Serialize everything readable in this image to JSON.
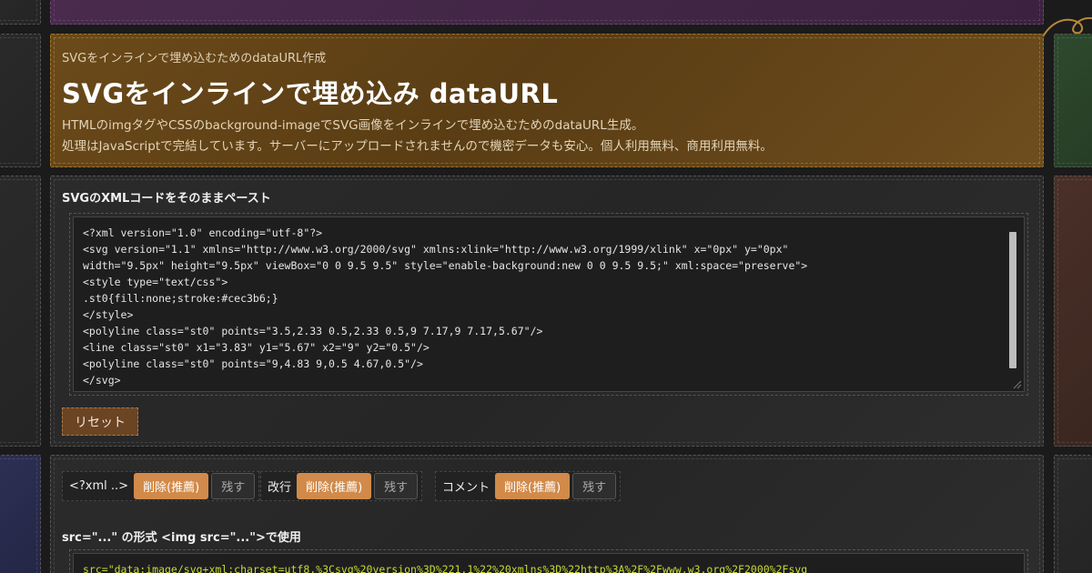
{
  "header": {
    "subtitle": "SVGをインラインで埋め込むためのdataURL作成",
    "title": "SVGをインラインで埋め込み dataURL",
    "description_line1": "HTMLのimgタグやCSSのbackground-imageでSVG画像をインラインで埋め込むためのdataURL生成。",
    "description_line2": "処理はJavaScriptで完結しています。サーバーにアップロードされませんので機密データも安心。個人利用無料、商用利用無料。"
  },
  "input_section": {
    "label": "SVGのXMLコードをそのままペースト",
    "code_lines": [
      "<?xml version=\"1.0\" encoding=\"utf-8\"?>",
      "<svg version=\"1.1\" xmlns=\"http://www.w3.org/2000/svg\" xmlns:xlink=\"http://www.w3.org/1999/xlink\" x=\"0px\" y=\"0px\"",
      "width=\"9.5px\" height=\"9.5px\" viewBox=\"0 0 9.5 9.5\" style=\"enable-background:new 0 0 9.5 9.5;\" xml:space=\"preserve\">",
      "<style type=\"text/css\">",
      ".st0{fill:none;stroke:#cec3b6;}",
      "</style>",
      "<polyline class=\"st0\" points=\"3.5,2.33 0.5,2.33 0.5,9 7.17,9 7.17,5.67\"/>",
      "<line class=\"st0\" x1=\"3.83\" y1=\"5.67\" x2=\"9\" y2=\"0.5\"/>",
      "<polyline class=\"st0\" points=\"9,4.83 9,0.5 4.67,0.5\"/>",
      "</svg>"
    ],
    "reset_label": "リセット"
  },
  "options": [
    {
      "label": "<?xml ..>",
      "on": "削除(推薦)",
      "off": "残す"
    },
    {
      "label": "改行",
      "on": "削除(推薦)",
      "off": "残す"
    },
    {
      "label": "コメント",
      "on": "削除(推薦)",
      "off": "残す"
    }
  ],
  "output_section": {
    "label": "src=\"...\" の形式 <img src=\"...\">で使用",
    "code": "src=\"data:image/svg+xml;charset=utf8,%3Csvg%20version%3D%221.1%22%20xmlns%3D%22http%3A%2F%2Fwww.w3.org%2F2000%2Fsvg"
  },
  "colors": {
    "accent": "#d18a4a",
    "header_bg": "#6b4a1a",
    "output_code": "#c8d93a"
  }
}
